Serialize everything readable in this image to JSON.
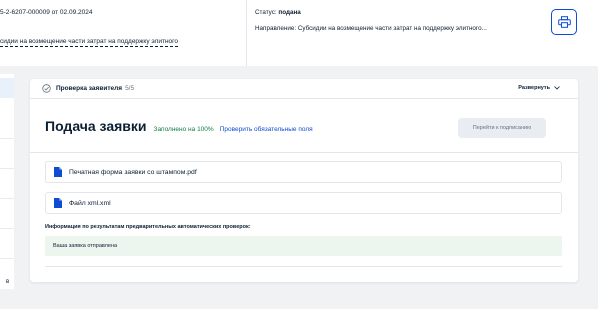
{
  "header": {
    "application_number": "5-2-6207-000009 от 02.09.2024",
    "direction_short": "сидии на возмещение части затрат на поддержку элитного",
    "status_label": "Статус:",
    "status_value": "подана",
    "direction_label": "Направление:",
    "direction_value": "Субсидии на возмещение части затрат на поддержку элитного...",
    "print_icon": "printer-icon"
  },
  "left_panel": {
    "glyph": "в"
  },
  "checks": {
    "icon": "check-circle-icon",
    "label": "Проверка заявителя",
    "count": "5/5",
    "expand_label": "Развернуть",
    "expand_icon": "chevron-down-icon"
  },
  "submission": {
    "title": "Подача заявки",
    "fill_status": "Заполнено на 100%",
    "check_link": "Проверить обязательные поля",
    "sign_button": "Перейти к подписанию",
    "files": [
      {
        "name": "Печатная форма заявки со штампом.pdf",
        "icon": "document-icon"
      },
      {
        "name": "Файл xml.xml",
        "icon": "document-icon"
      }
    ],
    "info_label": "Информация по результатам предварительных автоматических проверок:",
    "result_text": "Ваша заявка отправлена"
  },
  "colors": {
    "accent": "#0d4cd3",
    "success": "#0e7d4a",
    "success_bg": "#edf6ee",
    "background": "#f1f2f4"
  }
}
